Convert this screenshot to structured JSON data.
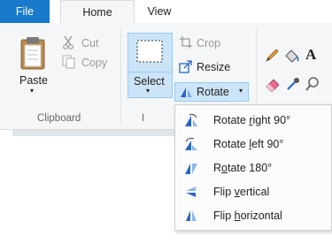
{
  "tabs": {
    "file": "File",
    "home": "Home",
    "view": "View"
  },
  "clipboard": {
    "paste": "Paste",
    "cut": "Cut",
    "copy": "Copy",
    "group_label": "Clipboard"
  },
  "image": {
    "select": "Select",
    "crop": "Crop",
    "resize": "Resize",
    "rotate": "Rotate",
    "group_label": "I"
  },
  "rotate_menu": [
    {
      "pre": "Rotate ",
      "key": "r",
      "post": "ight 90°",
      "icon": "rotate-right-icon"
    },
    {
      "pre": "Rotate ",
      "key": "l",
      "post": "eft 90°",
      "icon": "rotate-left-icon"
    },
    {
      "pre": "R",
      "key": "o",
      "post": "tate 180°",
      "icon": "rotate-180-icon"
    },
    {
      "pre": "Flip ",
      "key": "v",
      "post": "ertical",
      "icon": "flip-vertical-icon"
    },
    {
      "pre": "Flip ",
      "key": "h",
      "post": "orizontal",
      "icon": "flip-horizontal-icon"
    }
  ],
  "colors": {
    "file_tab": "#1979ca",
    "selected_button": "#cce4f7",
    "selected_border": "#99c9ef",
    "ribbon": "#f5f6f7"
  }
}
